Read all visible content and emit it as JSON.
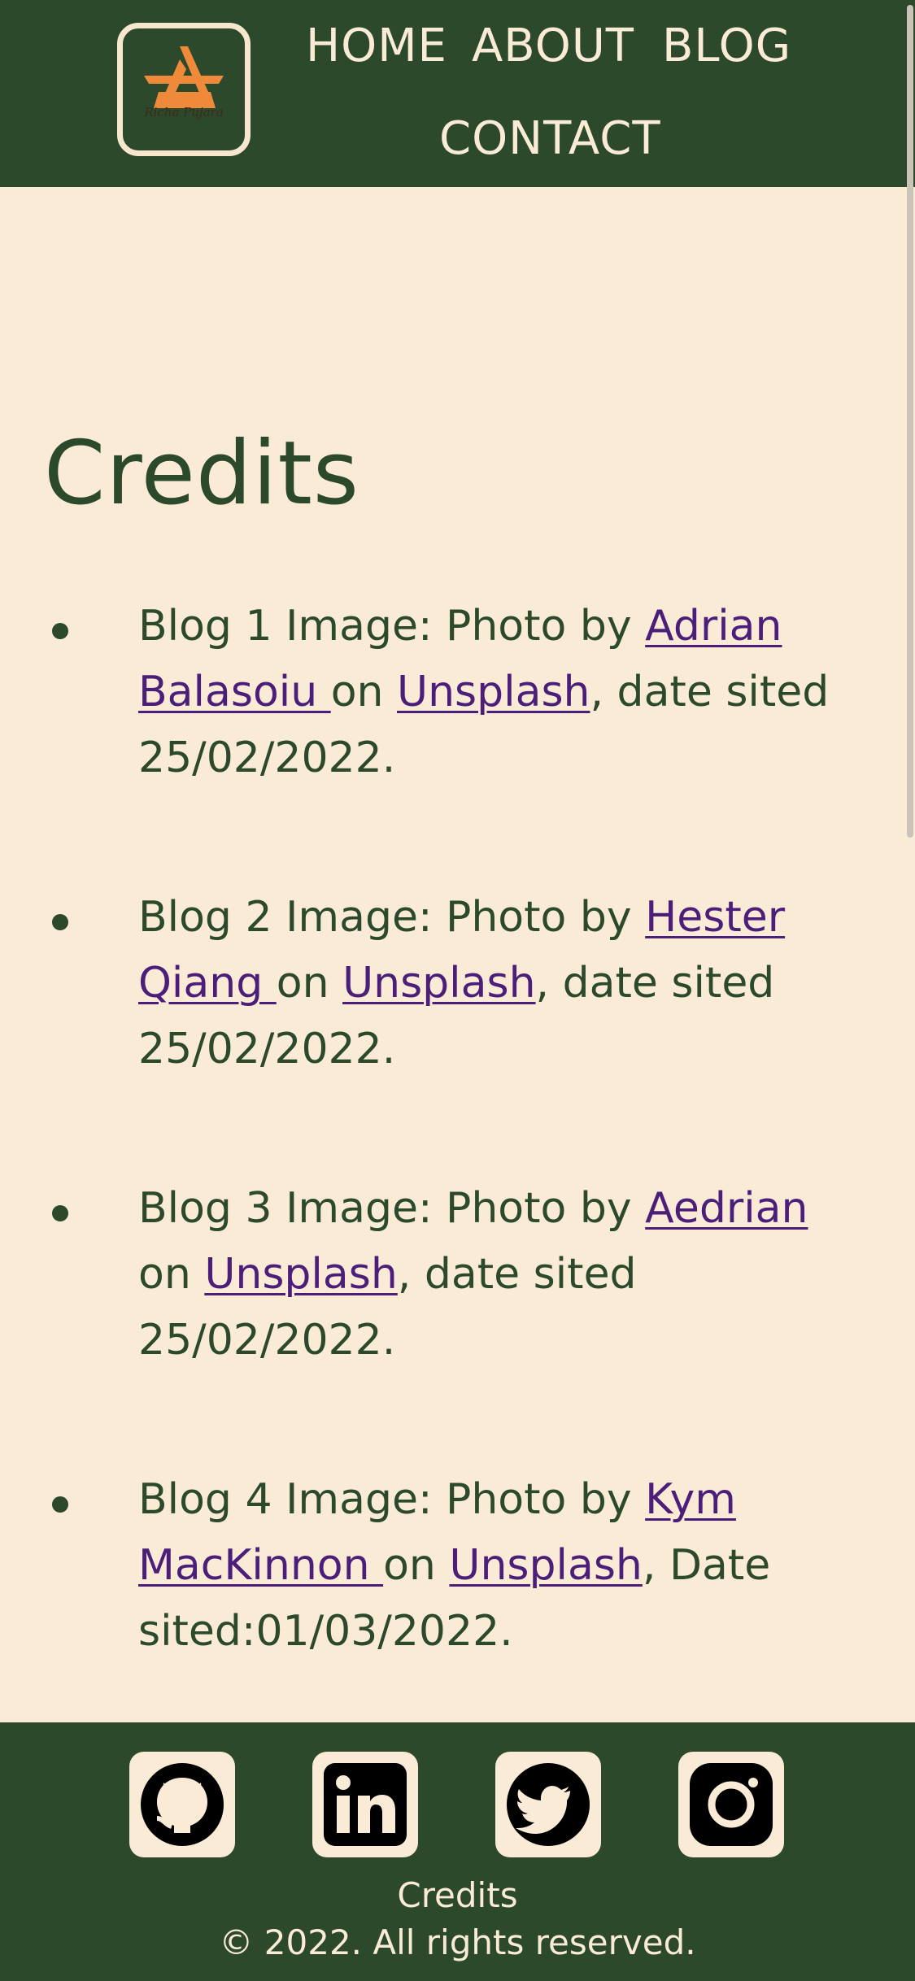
{
  "header": {
    "logo_text": "Richa Pujara",
    "nav": {
      "home": "HOME",
      "about": "ABOUT",
      "blog": "BLOG",
      "contact": "CONTACT"
    }
  },
  "main": {
    "title": "Credits",
    "credits": [
      {
        "prefix": "Blog 1 Image: Photo by ",
        "author": "Adrian Balasoiu ",
        "on": "on ",
        "site": "Unsplash",
        "suffix": ", date sited 25/02/2022."
      },
      {
        "prefix": "Blog 2 Image: Photo by ",
        "author": "Hester Qiang ",
        "on": "on ",
        "site": "Unsplash",
        "suffix": ", date sited 25/02/2022."
      },
      {
        "prefix": "Blog 3 Image: Photo by ",
        "author": "Aedrian",
        "on": " on ",
        "site": "Unsplash",
        "suffix": ", date sited 25/02/2022."
      },
      {
        "prefix": "Blog 4 Image: Photo by ",
        "author": "Kym MacKinnon ",
        "on": "on ",
        "site": "Unsplash",
        "suffix": ", Date sited:01/03/2022."
      }
    ]
  },
  "footer": {
    "social_icons": [
      "github-icon",
      "linkedin-icon",
      "twitter-icon",
      "instagram-icon"
    ],
    "credits_link": "Credits",
    "copyright": "© 2022. All rights reserved."
  },
  "colors": {
    "header_bg": "#2c4a2b",
    "page_bg": "#faebd7",
    "link": "#4b1e79",
    "logo_accent": "#ef8a3a"
  }
}
